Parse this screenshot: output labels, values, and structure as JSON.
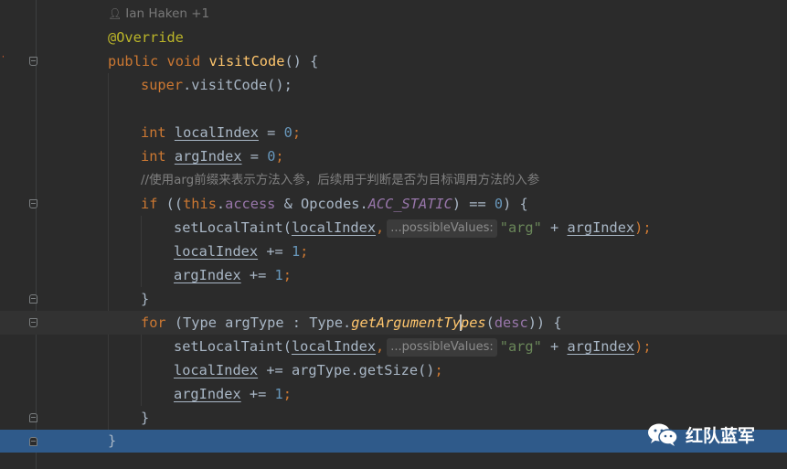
{
  "blame": {
    "author": "Ian Haken +1",
    "icon": "user-icon"
  },
  "code": {
    "annotation": "@Override",
    "signature": {
      "kw1": "public",
      "kw2": "void",
      "method": "visitCode",
      "rest": "() {"
    },
    "super_call": {
      "kw": "super",
      "rest": ".visitCode();"
    },
    "local_index_decl": {
      "type": "int",
      "var": "localIndex",
      "op": " = ",
      "val": "0",
      "semi": ";"
    },
    "arg_index_decl": {
      "type": "int",
      "var": "argIndex",
      "op": " = ",
      "val": "0",
      "semi": ";"
    },
    "comment": "//使用arg前缀来表示方法入参，后续用于判断是否为目标调用方法的入参",
    "if_stmt": {
      "kw": "if",
      "p1": " ((",
      "this_kw": "this",
      "p2": ".",
      "field": "access",
      "p3": " & Opcodes.",
      "const": "ACC_STATIC",
      "p4": ") == ",
      "val": "0",
      "p5": ") {"
    },
    "set_taint_1": {
      "fn": "setLocalTaint(",
      "arg": "localIndex",
      "comma": ",",
      "hint": "...possibleValues:",
      "str": "\"arg\"",
      "plus": " + ",
      "arg2": "argIndex",
      "close": ");"
    },
    "local_inc": {
      "var": "localIndex",
      "op": " += ",
      "val": "1",
      "semi": ";"
    },
    "arg_inc": {
      "var": "argIndex",
      "op": " += ",
      "val": "1",
      "semi": ";"
    },
    "close_if": "}",
    "for_stmt": {
      "kw": "for",
      "p1": " (Type argType : Type.",
      "method_a": "getArgumentTy",
      "method_b": "pes",
      "p2": "(",
      "param": "desc",
      "p3": ")) {"
    },
    "set_taint_2": {
      "fn": "setLocalTaint(",
      "arg": "localIndex",
      "comma": ",",
      "hint": "...possibleValues:",
      "str": "\"arg\"",
      "plus": " + ",
      "arg2": "argIndex",
      "close": ");"
    },
    "local_add": {
      "var": "localIndex",
      "op": " += argType.getSize()",
      "semi": ";"
    },
    "arg_inc_2": {
      "var": "argIndex",
      "op": " += ",
      "val": "1",
      "semi": ";"
    },
    "close_for": "}",
    "close_method": "}"
  },
  "gutter": {
    "override_marker": "↑",
    "override_icon": "override-arrow-icon"
  },
  "watermark": {
    "text": "红队蓝军",
    "icon": "wechat-icon"
  }
}
